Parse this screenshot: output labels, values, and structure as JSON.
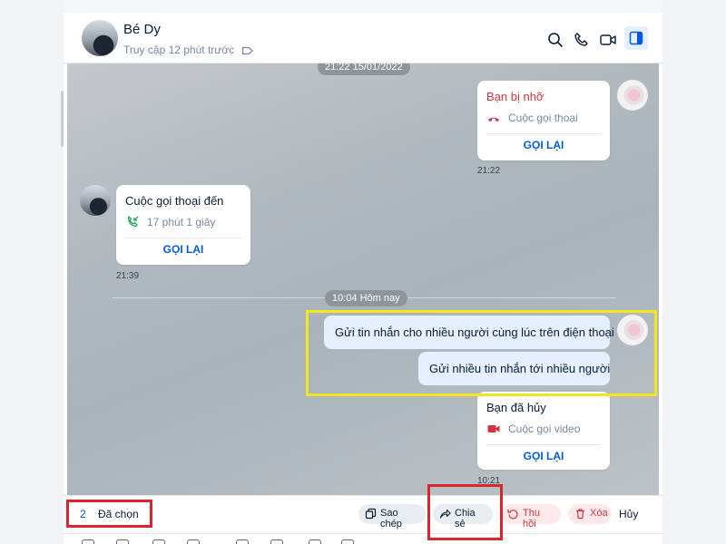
{
  "header": {
    "contact_name": "Bé Dy",
    "status": "Truy cập 12 phút trước",
    "icons": [
      "tag-icon",
      "search-icon",
      "phone-icon",
      "video-icon",
      "sidebar-toggle-icon"
    ]
  },
  "chat": {
    "date_top": "21:22 15/01/2022",
    "missed_call": {
      "title": "Bạn bị nhỡ",
      "subtitle": "Cuộc gọi thoại",
      "button": "GỌI LẠI",
      "time": "21:22"
    },
    "incoming_call": {
      "title": "Cuộc gọi thoại đến",
      "subtitle": "17 phút 1 giây",
      "button": "GỌI LẠI",
      "time": "21:39"
    },
    "date_today": "10:04 Hôm nay",
    "messages": [
      "Gửi tin nhắn cho nhiều người cùng lúc trên điện thoại",
      "Gửi nhiều tin nhắn tới nhiều người"
    ],
    "cancelled_call": {
      "title": "Bạn đã hủy",
      "subtitle": "Cuộc gọi video",
      "button": "GỌI LẠI",
      "time": "10:21"
    }
  },
  "actionbar": {
    "selected_count": "2",
    "selected_label": "Đã chọn",
    "copy_label": "Sao chép",
    "share_label": "Chia sẻ",
    "recall_label": "Thu hồi",
    "delete_label": "Xóa",
    "cancel_label": "Hủy"
  },
  "colors": {
    "accent": "#005ae0",
    "missed": "#d6333e",
    "highlight_yellow": "#f4e51c",
    "highlight_red": "#d9262c"
  }
}
